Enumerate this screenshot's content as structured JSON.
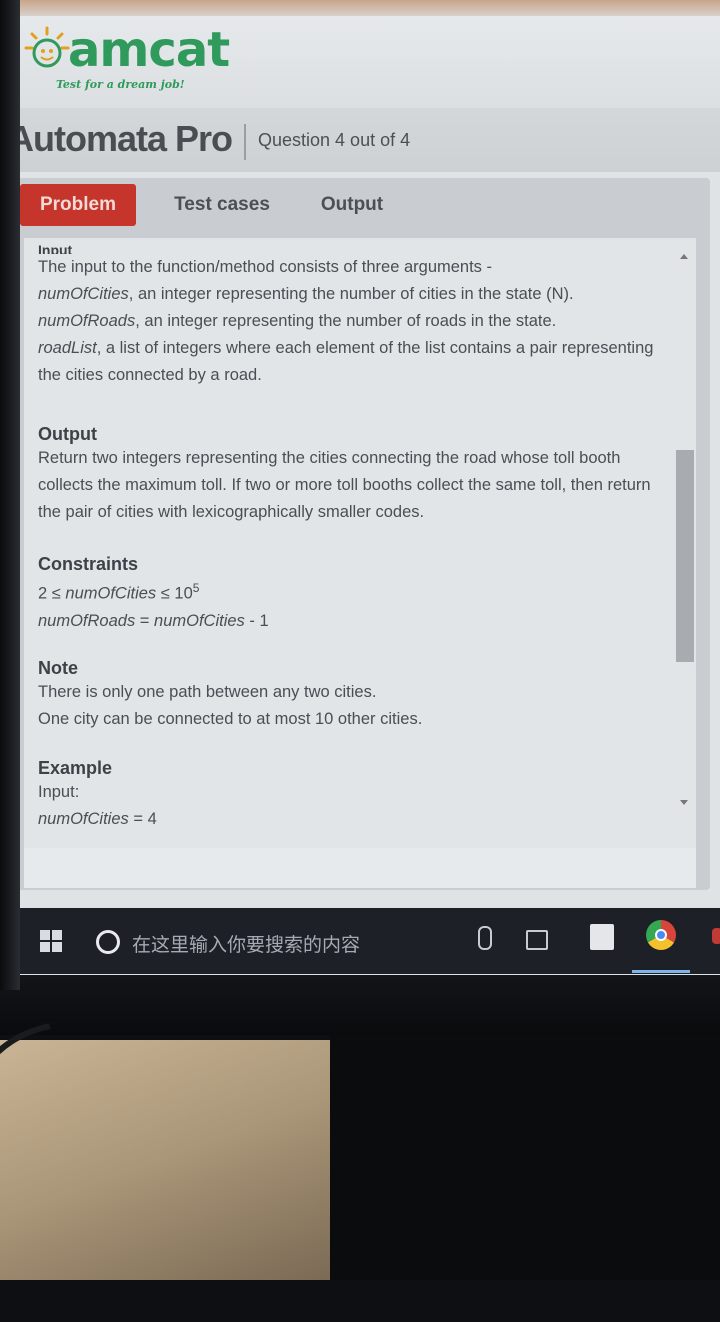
{
  "header": {
    "logo_word": "amcat",
    "tagline": "Test for a dream job!",
    "app_title": "Automata Pro",
    "question_counter": "Question 4 out of 4"
  },
  "tabs": [
    {
      "label": "Problem",
      "active": true
    },
    {
      "label": "Test cases",
      "active": false
    },
    {
      "label": "Output",
      "active": false
    }
  ],
  "problem": {
    "input_heading": "Input",
    "input_intro": "The input to the function/method consists of three arguments -",
    "arg1_name": "numOfCities",
    "arg1_desc": ", an integer representing the number of cities in the state (N).",
    "arg2_name": "numOfRoads",
    "arg2_desc": ", an integer representing the number of roads in the state.",
    "arg3_name": "roadList",
    "arg3_desc": ", a list of integers where each element of the list contains a pair representing",
    "arg3_desc_cont": "the cities connected by a road.",
    "output_heading": "Output",
    "output_line1": "Return two integers representing the cities connecting the road whose toll booth",
    "output_line2": "collects the maximum toll. If two or more toll booths collect the same toll, then return",
    "output_line3": "the pair of cities with lexicographically smaller codes.",
    "constraints_heading": "Constraints",
    "constraint1_prefix": "2 ≤ ",
    "constraint1_var": "numOfCities",
    "constraint1_suffix": " ≤ 10",
    "constraint1_exp": "5",
    "constraint2_var1": "numOfRoads",
    "constraint2_eq": " = ",
    "constraint2_var2": "numOfCities",
    "constraint2_suffix": "  - 1",
    "note_heading": "Note",
    "note_line1": "There is only one path between any two cities.",
    "note_line2": "One city can be connected to at most 10 other cities.",
    "example_heading": "Example",
    "example_input_label": "Input:",
    "example_var": "numOfCities",
    "example_value": " = 4"
  },
  "taskbar": {
    "search_placeholder": "在这里输入你要搜索的内容"
  },
  "colors": {
    "brand_green": "#2f9a5b",
    "active_tab": "#c5352b",
    "taskbar": "#1d2026"
  },
  "icons": [
    "sun-logo-icon",
    "windows-start-icon",
    "cortana-icon",
    "microphone-icon",
    "task-view-icon",
    "store-icon",
    "chrome-icon",
    "edge-icon"
  ]
}
